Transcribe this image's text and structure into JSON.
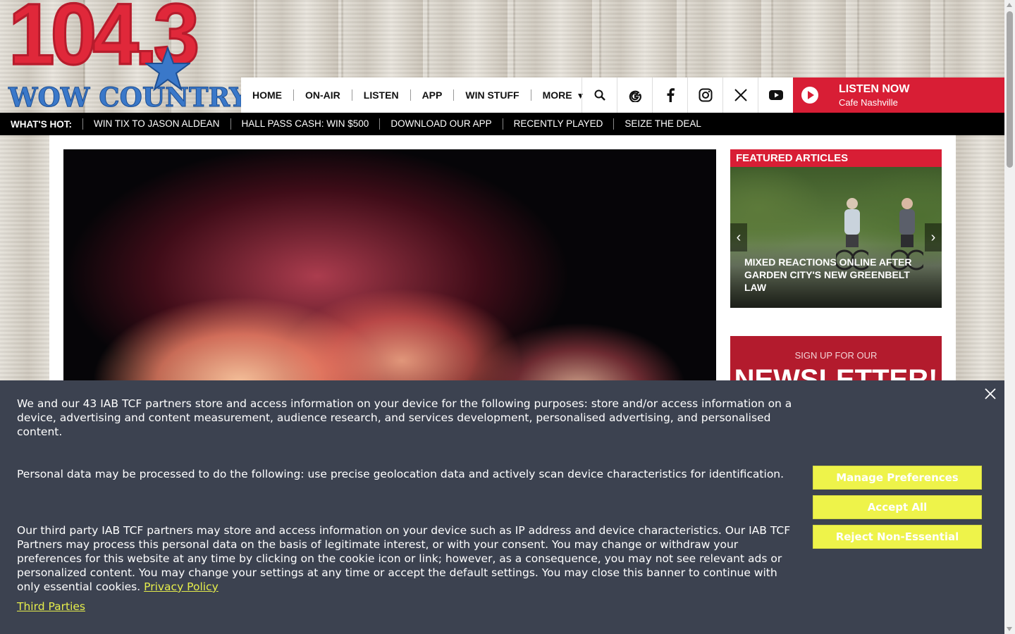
{
  "logo": {
    "number": "104.3",
    "name": "WOW COUNTRY"
  },
  "nav": {
    "items": [
      "HOME",
      "ON-AIR",
      "LISTEN",
      "APP",
      "WIN STUFF",
      "MORE"
    ],
    "icons": [
      "search-icon",
      "google-icon",
      "facebook-icon",
      "instagram-icon",
      "x-icon",
      "youtube-icon"
    ],
    "listen_now": "LISTEN NOW",
    "station": "Cafe Nashville"
  },
  "hot": {
    "title": "WHAT'S HOT:",
    "items": [
      "WIN TIX TO JASON ALDEAN",
      "HALL PASS CASH: WIN $500",
      "DOWNLOAD OUR APP",
      "RECENTLY PLAYED",
      "SEIZE THE DEAL"
    ]
  },
  "sidebar": {
    "featured_heading": "FEATURED ARTICLES",
    "featured_title": "MIXED REACTIONS ONLINE AFTER GARDEN CITY'S NEW GREENBELT LAW",
    "newsletter_sub": "SIGN UP FOR OUR",
    "newsletter_main": "NEWSLETTER!"
  },
  "cookie": {
    "p1": "We and our 43 IAB TCF partners store and access information on your device for the following purposes: store and/or access information on a device, advertising and content measurement, audience research, and services development, personalised advertising, and personalised content.",
    "p2": "Personal data may be processed to do the following: use precise geolocation data and actively scan device characteristics for identification.",
    "p3": "Our third party IAB TCF partners may store and access information on your device such as IP address and device characteristics. Our IAB TCF Partners may process this personal data on the basis of legitimate interest, or with your consent. You may change or withdraw your preferences for this website at any time by clicking on the cookie icon or link; however, as a consequence, you may not see relevant ads or personalized content. You may change your settings at any time or accept the default settings. You may close this banner to continue with only essential cookies.",
    "privacy_link": "Privacy Policy",
    "third_parties_link": "Third Parties",
    "manage": "Manage Preferences",
    "accept": "Accept All",
    "reject": "Reject Non-Essential"
  },
  "colors": {
    "brand_red": "#d81e35",
    "banner_bg": "#3c4250",
    "button_yellow": "#eef34a",
    "link_yellow": "#e6ee4b"
  }
}
